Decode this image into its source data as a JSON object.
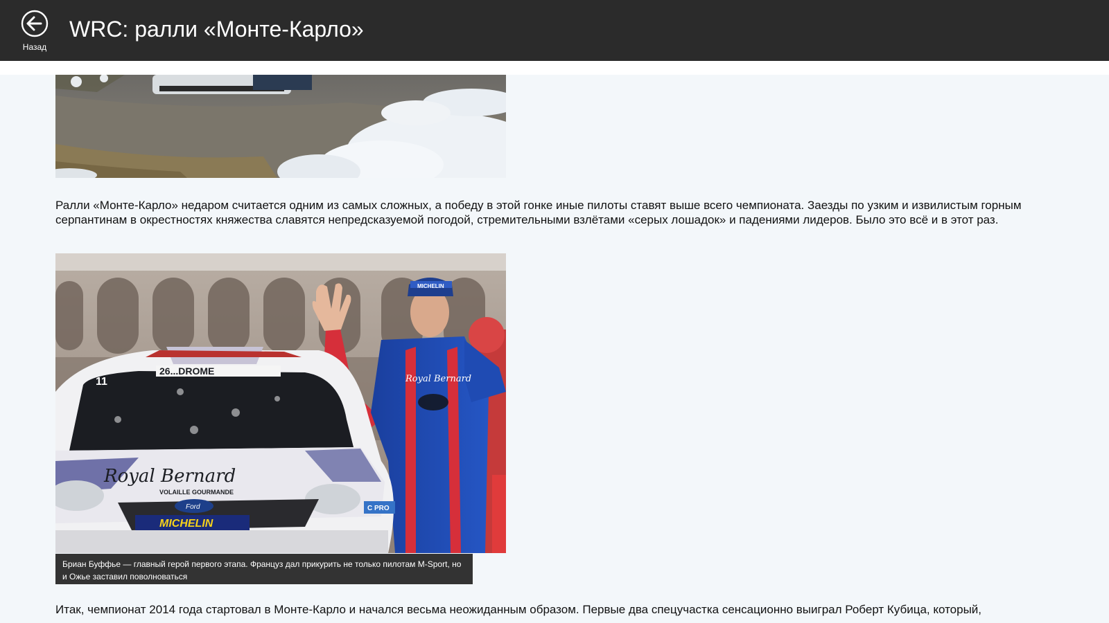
{
  "header": {
    "back_label": "Назад",
    "title": "WRC: ралли «Монте-Карло»"
  },
  "article": {
    "paragraph_1": "Ралли «Монте-Карло» недаром считается одним из самых сложных, а победу в этой гонке иные пилоты ставят выше всего чемпионата. Заезды по узким и извилистым горным серпантинам в окрестностях княжества славятся непредсказуемой погодой, стремительными взлётами «серых лошадок» и падениями лидеров. Было это всё и в этот раз.",
    "photo_2_caption": "Бриан Буффье — главный герой первого этапа. Француз дал прикурить не только пилотам M-Sport, но и Ожье заставил поволноваться",
    "paragraph_2": "Итак, чемпионат 2014 года стартовал в Монте-Карло и начался весьма неожиданным образом. Первые два спецучастка сенсационно выиграл Роберт Кубица, который,"
  },
  "photo_text": {
    "car_number": "11",
    "windshield_banner": "26...DROME",
    "hood_logo": "Royal Bernard",
    "hood_sub": "VOLAILLE GOURMANDE",
    "bumper_sponsor": "MICHELIN",
    "bumper_badge": "C PRO",
    "grille_badge": "Ford",
    "suit_logo": "Royal Bernard",
    "cap_logo": "MICHELIN"
  },
  "icons": {
    "back": "back-arrow-circle-icon"
  },
  "colors": {
    "header_bg": "#2b2b2b",
    "page_bg": "#f3f7fa",
    "caption_bg": "#333333",
    "text": "#111111"
  }
}
